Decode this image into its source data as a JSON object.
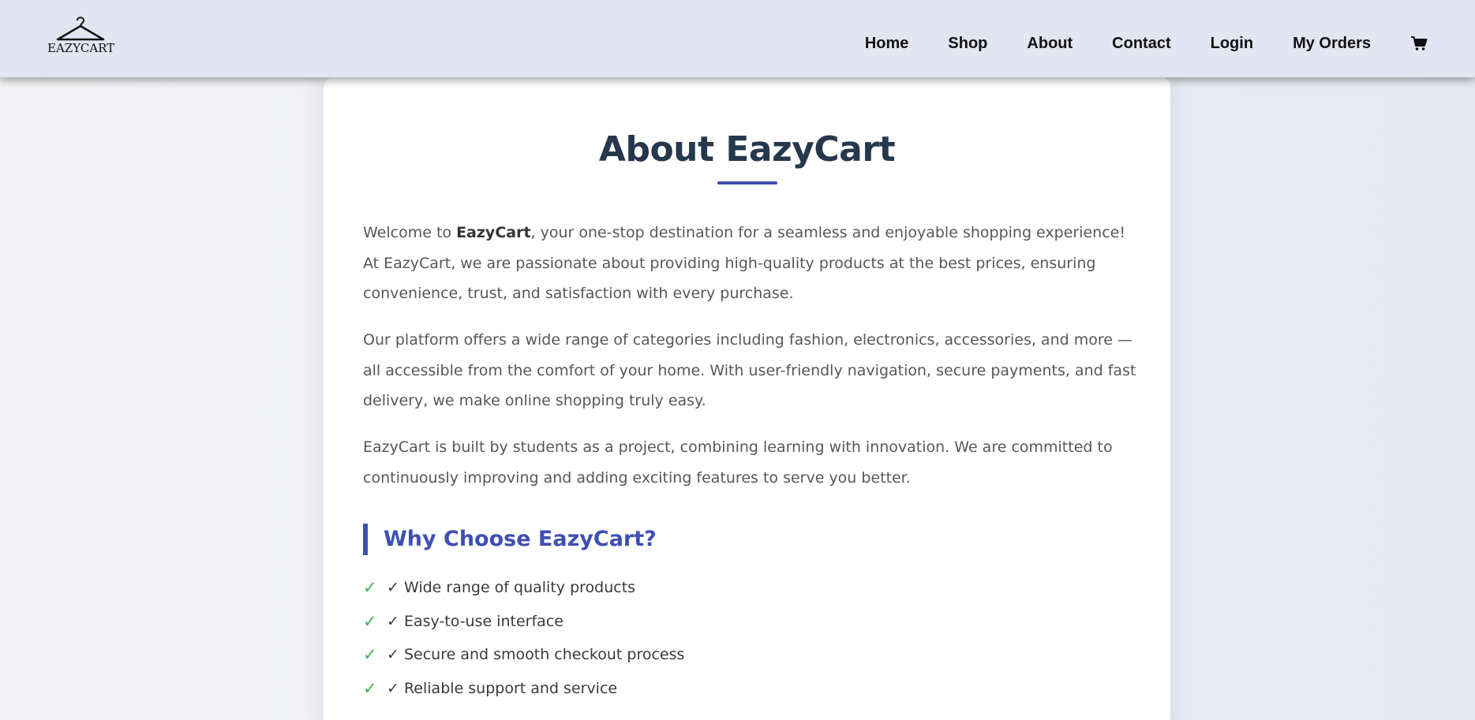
{
  "brand": {
    "logo_text": "EAZYCART"
  },
  "nav": {
    "items": [
      {
        "label": "Home"
      },
      {
        "label": "Shop"
      },
      {
        "label": "About"
      },
      {
        "label": "Contact"
      },
      {
        "label": "Login"
      },
      {
        "label": "My Orders"
      }
    ],
    "cart_icon": "cart-icon"
  },
  "about": {
    "title": "About EazyCart",
    "p1_before": "Welcome to ",
    "p1_bold": "EazyCart",
    "p1_after": ", your one-stop destination for a seamless and enjoyable shopping experience! At EazyCart, we are passionate about providing high-quality products at the best prices, ensuring convenience, trust, and satisfaction with every purchase.",
    "p2": "Our platform offers a wide range of categories including fashion, electronics, accessories, and more — all accessible from the comfort of your home. With user-friendly navigation, secure payments, and fast delivery, we make online shopping truly easy.",
    "p3": "EazyCart is built by students as a project, combining learning with innovation. We are committed to continuously improving and adding exciting features to serve you better."
  },
  "why": {
    "heading": "Why Choose EazyCart?",
    "check_glyph": "✓",
    "features": [
      "✓ Wide range of quality products",
      "✓ Easy-to-use interface",
      "✓ Secure and smooth checkout process",
      "✓ Reliable support and service"
    ]
  },
  "colors": {
    "accent": "#3f4fb2",
    "title": "#26384b",
    "check": "#3fb24a",
    "navbar_bg": "#e3e5f2"
  }
}
